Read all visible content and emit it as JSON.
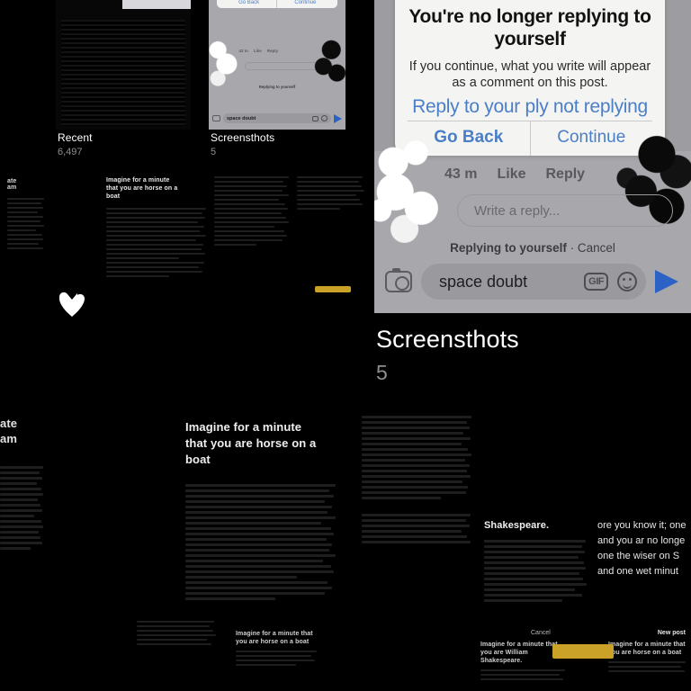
{
  "app": {
    "name": "Photos",
    "screen": "Albums"
  },
  "colors": {
    "background": "#000000",
    "link_blue": "#4a7fc8",
    "send_blue": "#2b62c4",
    "alert_bg": "#f4f4f2",
    "ig_bg": "#a8a8ac",
    "count_gray": "#8e8e93",
    "highlight_yellow": "#c9a227"
  },
  "albums": [
    {
      "title": "Recent",
      "count": "6,497"
    },
    {
      "title": "Screensthots",
      "count": "5"
    }
  ],
  "featured_album": {
    "title": "Screensthots",
    "count": "5"
  },
  "instagram_screenshot": {
    "alert": {
      "title": "You're no longer replying to yourself",
      "body": "If you continue, what you write will appear as a comment on this post.",
      "overflow_line": "Reply to your ply not replying",
      "buttons": [
        {
          "label": "Go Back",
          "emphasis": "bold"
        },
        {
          "label": "Continue",
          "emphasis": "normal"
        }
      ]
    },
    "comment_meta": [
      "43 m",
      "Like",
      "Reply"
    ],
    "reply_field_placeholder": "Write a reply...",
    "replying_status": "Replying to yourself",
    "replying_separator": "·",
    "cancel_label": "Cancel",
    "composer": {
      "text": "space doubt",
      "camera_icon": "camera-icon",
      "gif_label": "GIF",
      "emoji_icon": "smiley-icon",
      "send_icon": "send-arrow-icon"
    }
  },
  "documents": {
    "headline": "Imagine for a minute that you are horse on a boat",
    "headline_wrapped": [
      "Imagine for a minute",
      "that you are horse on a",
      "boat"
    ],
    "shakespeare_heading": "Shakespeare.",
    "tail_lines": [
      "ore you know it; one",
      "and you ar no longe",
      "one the wiser on S",
      "and one wet minut"
    ],
    "clipped_left": [
      "ate",
      "am"
    ],
    "card_titles": [
      "Imagine for a minute that you are William Shakespeare.",
      "Imagine for a minute that you are horse on a boat"
    ],
    "sheet_buttons": [
      {
        "label": "Cancel",
        "emphasis": "normal"
      },
      {
        "label": "New post",
        "emphasis": "bold"
      }
    ]
  }
}
